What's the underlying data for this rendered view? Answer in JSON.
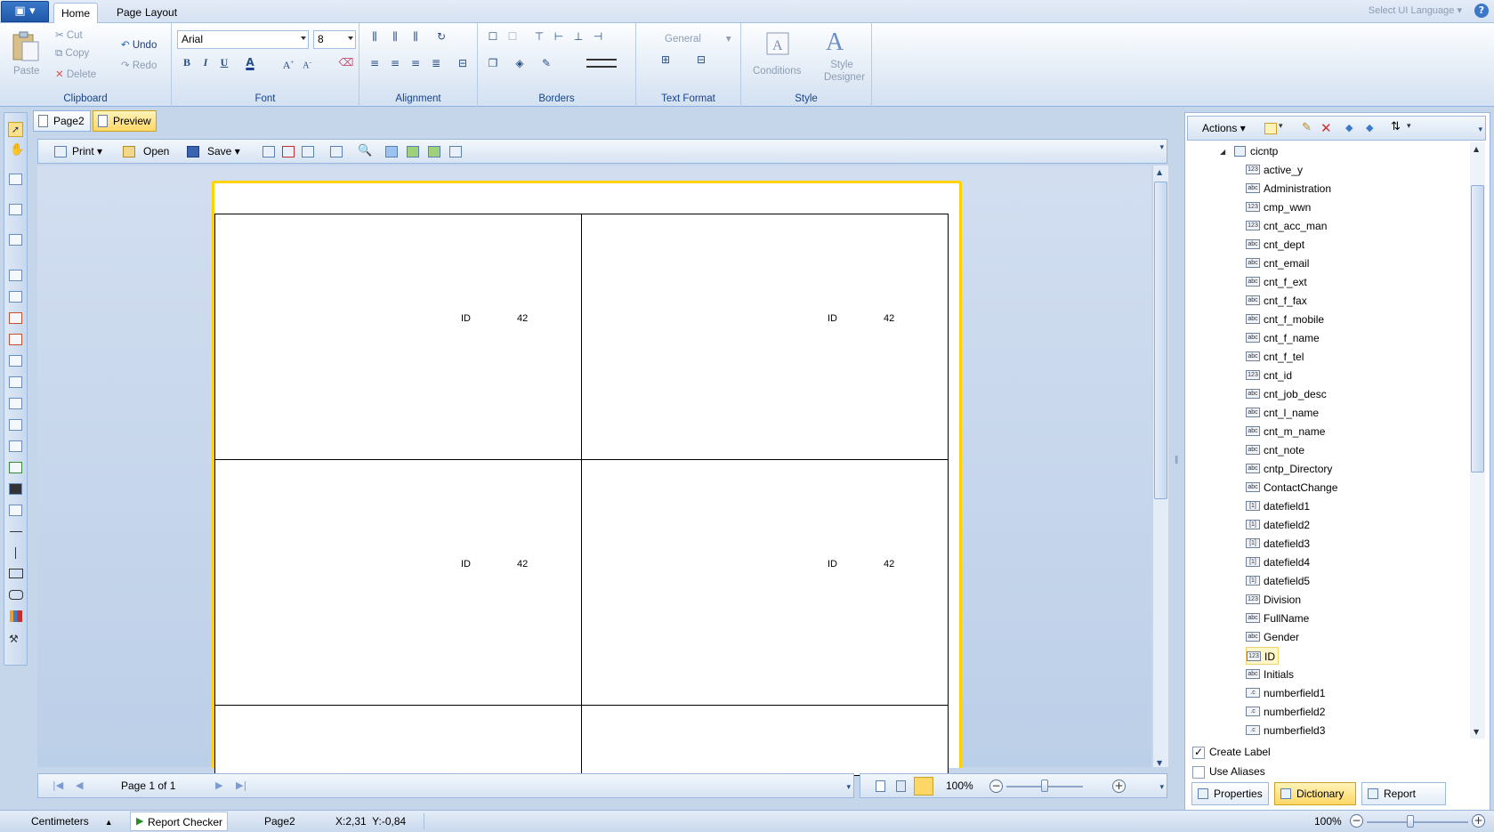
{
  "ribbon": {
    "tabs": [
      "Home",
      "Page",
      "Layout"
    ],
    "language": "Select UI Language",
    "clipboard": {
      "paste": "Paste",
      "cut": "Cut",
      "copy": "Copy",
      "delete": "Delete",
      "label": "Clipboard"
    },
    "undo": {
      "undo": "Undo",
      "redo": "Redo"
    },
    "font": {
      "family": "Arial",
      "size": "8",
      "label": "Font"
    },
    "alignment": {
      "label": "Alignment"
    },
    "borders": {
      "label": "Borders"
    },
    "text_format": {
      "value": "General",
      "label": "Text Format"
    },
    "style": {
      "conditions": "Conditions",
      "style_designer": "Style Designer",
      "label": "Style"
    }
  },
  "doc_tabs": {
    "page": "Page2",
    "preview": "Preview"
  },
  "toolbar": {
    "print": "Print",
    "open": "Open",
    "save": "Save"
  },
  "report": {
    "cells": [
      {
        "label": "ID",
        "value": "42"
      },
      {
        "label": "ID",
        "value": "42"
      },
      {
        "label": "ID",
        "value": "42"
      },
      {
        "label": "ID",
        "value": "42"
      }
    ]
  },
  "nav": {
    "page_info": "Page 1 of 1",
    "zoom": "100%"
  },
  "dictionary": {
    "actions": "Actions",
    "root": "cicntp",
    "fields": [
      {
        "name": "active_y",
        "type": "123"
      },
      {
        "name": "Administration",
        "type": "abc"
      },
      {
        "name": "cmp_wwn",
        "type": "123"
      },
      {
        "name": "cnt_acc_man",
        "type": "123"
      },
      {
        "name": "cnt_dept",
        "type": "abc"
      },
      {
        "name": "cnt_email",
        "type": "abc"
      },
      {
        "name": "cnt_f_ext",
        "type": "abc"
      },
      {
        "name": "cnt_f_fax",
        "type": "abc"
      },
      {
        "name": "cnt_f_mobile",
        "type": "abc"
      },
      {
        "name": "cnt_f_name",
        "type": "abc"
      },
      {
        "name": "cnt_f_tel",
        "type": "abc"
      },
      {
        "name": "cnt_id",
        "type": "123"
      },
      {
        "name": "cnt_job_desc",
        "type": "abc"
      },
      {
        "name": "cnt_l_name",
        "type": "abc"
      },
      {
        "name": "cnt_m_name",
        "type": "abc"
      },
      {
        "name": "cnt_note",
        "type": "abc"
      },
      {
        "name": "cntp_Directory",
        "type": "abc"
      },
      {
        "name": "ContactChange",
        "type": "abc"
      },
      {
        "name": "datefield1",
        "type": "date"
      },
      {
        "name": "datefield2",
        "type": "date"
      },
      {
        "name": "datefield3",
        "type": "date"
      },
      {
        "name": "datefield4",
        "type": "date"
      },
      {
        "name": "datefield5",
        "type": "date"
      },
      {
        "name": "Division",
        "type": "123"
      },
      {
        "name": "FullName",
        "type": "abc"
      },
      {
        "name": "Gender",
        "type": "abc"
      },
      {
        "name": "ID",
        "type": "123",
        "selected": true
      },
      {
        "name": "Initials",
        "type": "abc"
      },
      {
        "name": "numberfield1",
        "type": "num"
      },
      {
        "name": "numberfield2",
        "type": "num"
      },
      {
        "name": "numberfield3",
        "type": "num"
      }
    ],
    "create_label": "Create Label",
    "use_aliases": "Use Aliases",
    "tabs": [
      "Properties",
      "Dictionary",
      "Report Tree"
    ]
  },
  "status": {
    "units": "Centimeters",
    "report_checker": "Report Checker",
    "page": "Page2",
    "coords": "X:2,31  Y:-0,84",
    "zoom": "100%"
  }
}
